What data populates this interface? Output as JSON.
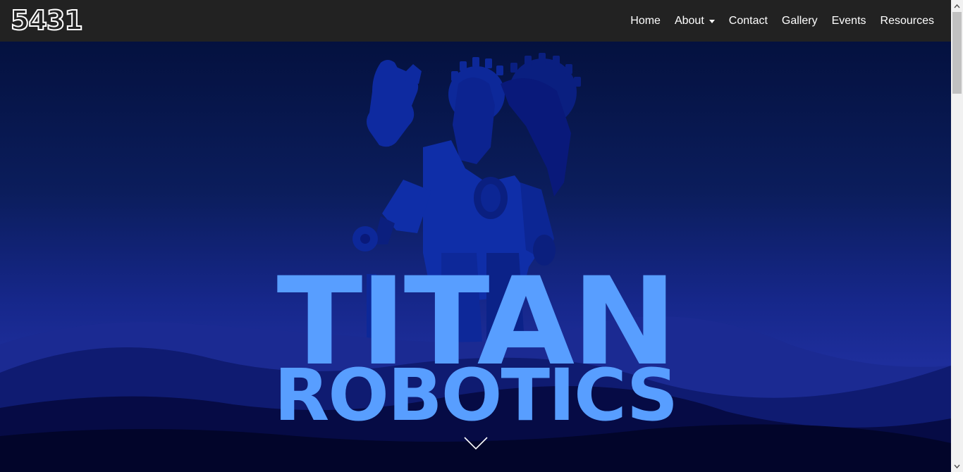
{
  "brand": {
    "logo_text": "5431"
  },
  "nav": {
    "items": [
      {
        "label": "Home"
      },
      {
        "label": "About",
        "dropdown": true
      },
      {
        "label": "Contact"
      },
      {
        "label": "Gallery"
      },
      {
        "label": "Events"
      },
      {
        "label": "Resources"
      }
    ]
  },
  "hero": {
    "title_line1": "TITAN",
    "title_line2": "ROBOTICS",
    "scroll_icon": "chevron-down-icon"
  },
  "colors": {
    "navbar_bg": "#222222",
    "title_color": "#589eff",
    "robot_color": "#0f2ea8",
    "sky_top": "#04113f",
    "sky_mid": "#16278a"
  }
}
